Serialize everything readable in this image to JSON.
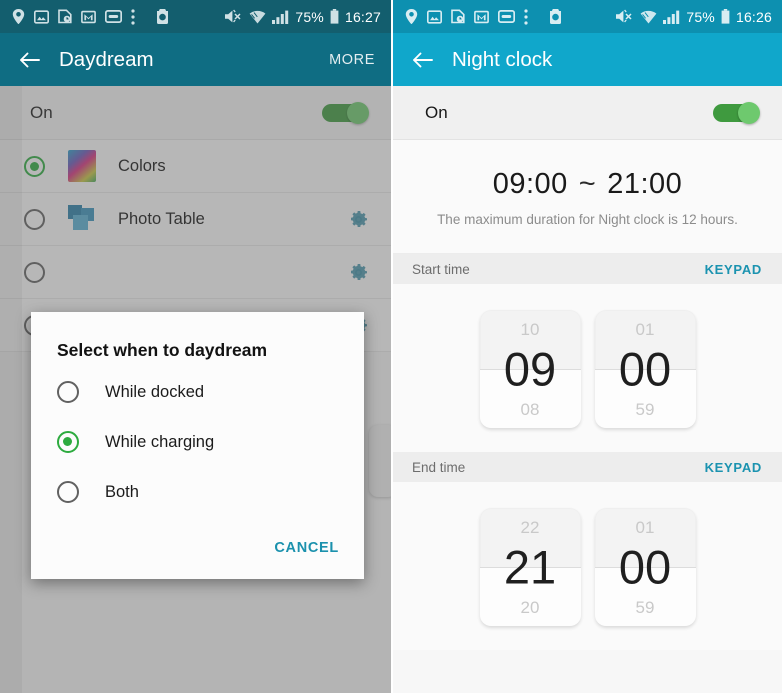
{
  "left": {
    "statusbar": {
      "icons": [
        "location-pin-icon",
        "photo-icon",
        "clock-document-icon",
        "gmail-icon",
        "card-icon",
        "overflow-dots-icon",
        "play-store-icon"
      ],
      "mute_icon": "mute-icon",
      "wifi_icon": "wifi-icon",
      "signal_icon": "signal-bars-icon",
      "battery": "75%",
      "battery_icon": "battery-icon",
      "time": "16:27"
    },
    "appbar": {
      "back_icon": "back-arrow-icon",
      "title": "Daydream",
      "more_label": "MORE"
    },
    "master_switch": {
      "label": "On",
      "state": "on"
    },
    "rows": [
      {
        "name": "Colors",
        "selected": true,
        "thumb": "colors-gradient-thumb",
        "gear": false
      },
      {
        "name": "Photo Table",
        "selected": false,
        "thumb": "photo-table-thumb",
        "gear": true
      },
      {
        "name": "",
        "selected": false,
        "thumb": "",
        "gear": true
      },
      {
        "name": "",
        "selected": false,
        "thumb": "",
        "gear": true
      }
    ],
    "dialog": {
      "title": "Select when to daydream",
      "options": [
        {
          "label": "While docked",
          "selected": false
        },
        {
          "label": "While charging",
          "selected": true
        },
        {
          "label": "Both",
          "selected": false
        }
      ],
      "cancel_label": "CANCEL"
    }
  },
  "right": {
    "statusbar": {
      "icons": [
        "location-pin-icon",
        "photo-icon",
        "clock-document-icon",
        "gmail-icon",
        "card-icon",
        "overflow-dots-icon",
        "play-store-icon"
      ],
      "battery": "75%",
      "time": "16:26"
    },
    "appbar": {
      "back_icon": "back-arrow-icon",
      "title": "Night clock"
    },
    "master_switch": {
      "label": "On",
      "state": "on"
    },
    "summary": {
      "start": "09:00",
      "separator": "~",
      "end": "21:00",
      "note": "The maximum duration for Night clock is 12 hours."
    },
    "start_section": {
      "label": "Start time",
      "keypad_label": "KEYPAD",
      "hour": {
        "prev": "10",
        "current": "09",
        "next": "08"
      },
      "minute": {
        "prev": "01",
        "current": "00",
        "next": "59"
      }
    },
    "end_section": {
      "label": "End time",
      "keypad_label": "KEYPAD",
      "hour": {
        "prev": "22",
        "current": "21",
        "next": "20"
      },
      "minute": {
        "prev": "01",
        "current": "00",
        "next": "59"
      }
    }
  },
  "colors": {
    "left_appbar": "#0f6d83",
    "left_status": "#135e6e",
    "right_appbar": "#10a7cb",
    "right_status": "#0d90b0",
    "accent_link": "#1b93b0",
    "toggle_on": "#6ec96e",
    "radio_selected": "#2dab3f"
  }
}
